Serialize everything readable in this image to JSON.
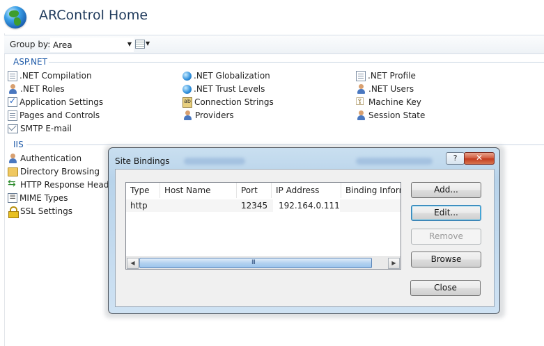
{
  "header": {
    "title": "ARControl Home"
  },
  "toolbar": {
    "group_by_label": "Group by:",
    "group_by_value": "Area"
  },
  "groups": {
    "aspnet": {
      "title": "ASP.NET",
      "items": [
        {
          "label": ".NET Compilation",
          "icon": "compilation-icon"
        },
        {
          "label": ".NET Roles",
          "icon": "roles-icon"
        },
        {
          "label": "Application Settings",
          "icon": "app-settings-icon"
        },
        {
          "label": "Pages and Controls",
          "icon": "pages-controls-icon"
        },
        {
          "label": "SMTP E-mail",
          "icon": "smtp-email-icon"
        },
        {
          "label": ".NET Globalization",
          "icon": "globalization-icon"
        },
        {
          "label": ".NET Trust Levels",
          "icon": "trust-levels-icon"
        },
        {
          "label": "Connection Strings",
          "icon": "connection-strings-icon"
        },
        {
          "label": "Providers",
          "icon": "providers-icon"
        },
        {
          "label": ".NET Profile",
          "icon": "profile-icon"
        },
        {
          "label": ".NET Users",
          "icon": "users-icon"
        },
        {
          "label": "Machine Key",
          "icon": "machine-key-icon"
        },
        {
          "label": "Session State",
          "icon": "session-state-icon"
        }
      ]
    },
    "iis": {
      "title": "IIS",
      "items": [
        {
          "label": "Authentication",
          "icon": "authentication-icon"
        },
        {
          "label": "Directory Browsing",
          "icon": "directory-browsing-icon"
        },
        {
          "label": "HTTP Response Headers",
          "icon": "http-response-headers-icon"
        },
        {
          "label": "MIME Types",
          "icon": "mime-types-icon"
        },
        {
          "label": "SSL Settings",
          "icon": "ssl-settings-icon"
        }
      ]
    }
  },
  "dialog": {
    "title": "Site Bindings",
    "help_label": "?",
    "close_label": "✕",
    "columns": [
      "Type",
      "Host Name",
      "Port",
      "IP Address",
      "Binding Inforn"
    ],
    "rows": [
      {
        "type": "http",
        "host_name": "",
        "port": "12345",
        "ip_address": "192.164.0.111",
        "binding_info": ""
      }
    ],
    "scroll_grip": "III",
    "buttons": {
      "add": "Add...",
      "edit": "Edit...",
      "remove": "Remove",
      "browse": "Browse",
      "close": "Close"
    }
  }
}
